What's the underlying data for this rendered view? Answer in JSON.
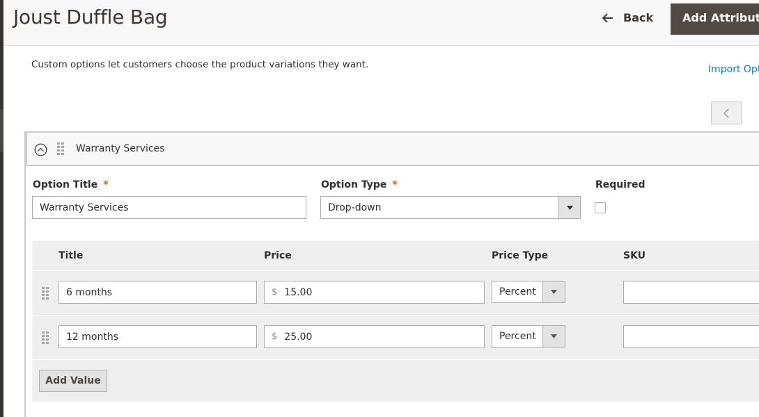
{
  "header": {
    "title": "Joust Duffle Bag",
    "back_label": "Back",
    "add_attribute_label": "Add Attribute"
  },
  "custom_options": {
    "intro": "Custom options let customers choose the product variations they want.",
    "import_link": "Import Options"
  },
  "option": {
    "header_title": "Warranty Services",
    "option_title_label": "Option Title",
    "option_title_value": "Warranty Services",
    "option_type_label": "Option Type",
    "option_type_value": "Drop-down",
    "required_label": "Required",
    "required_checked": false,
    "required_marker": "*",
    "values_table": {
      "columns": [
        "Title",
        "Price",
        "Price Type",
        "SKU"
      ],
      "currency_symbol": "$",
      "rows": [
        {
          "title": "6 months",
          "price": "15.00",
          "price_type": "Percent",
          "sku": ""
        },
        {
          "title": "12 months",
          "price": "25.00",
          "price_type": "Percent",
          "sku": ""
        }
      ],
      "add_value_label": "Add Value"
    }
  },
  "colors": {
    "primary_button": "#514943",
    "link": "#1979c3",
    "required_star": "#eb5202"
  }
}
